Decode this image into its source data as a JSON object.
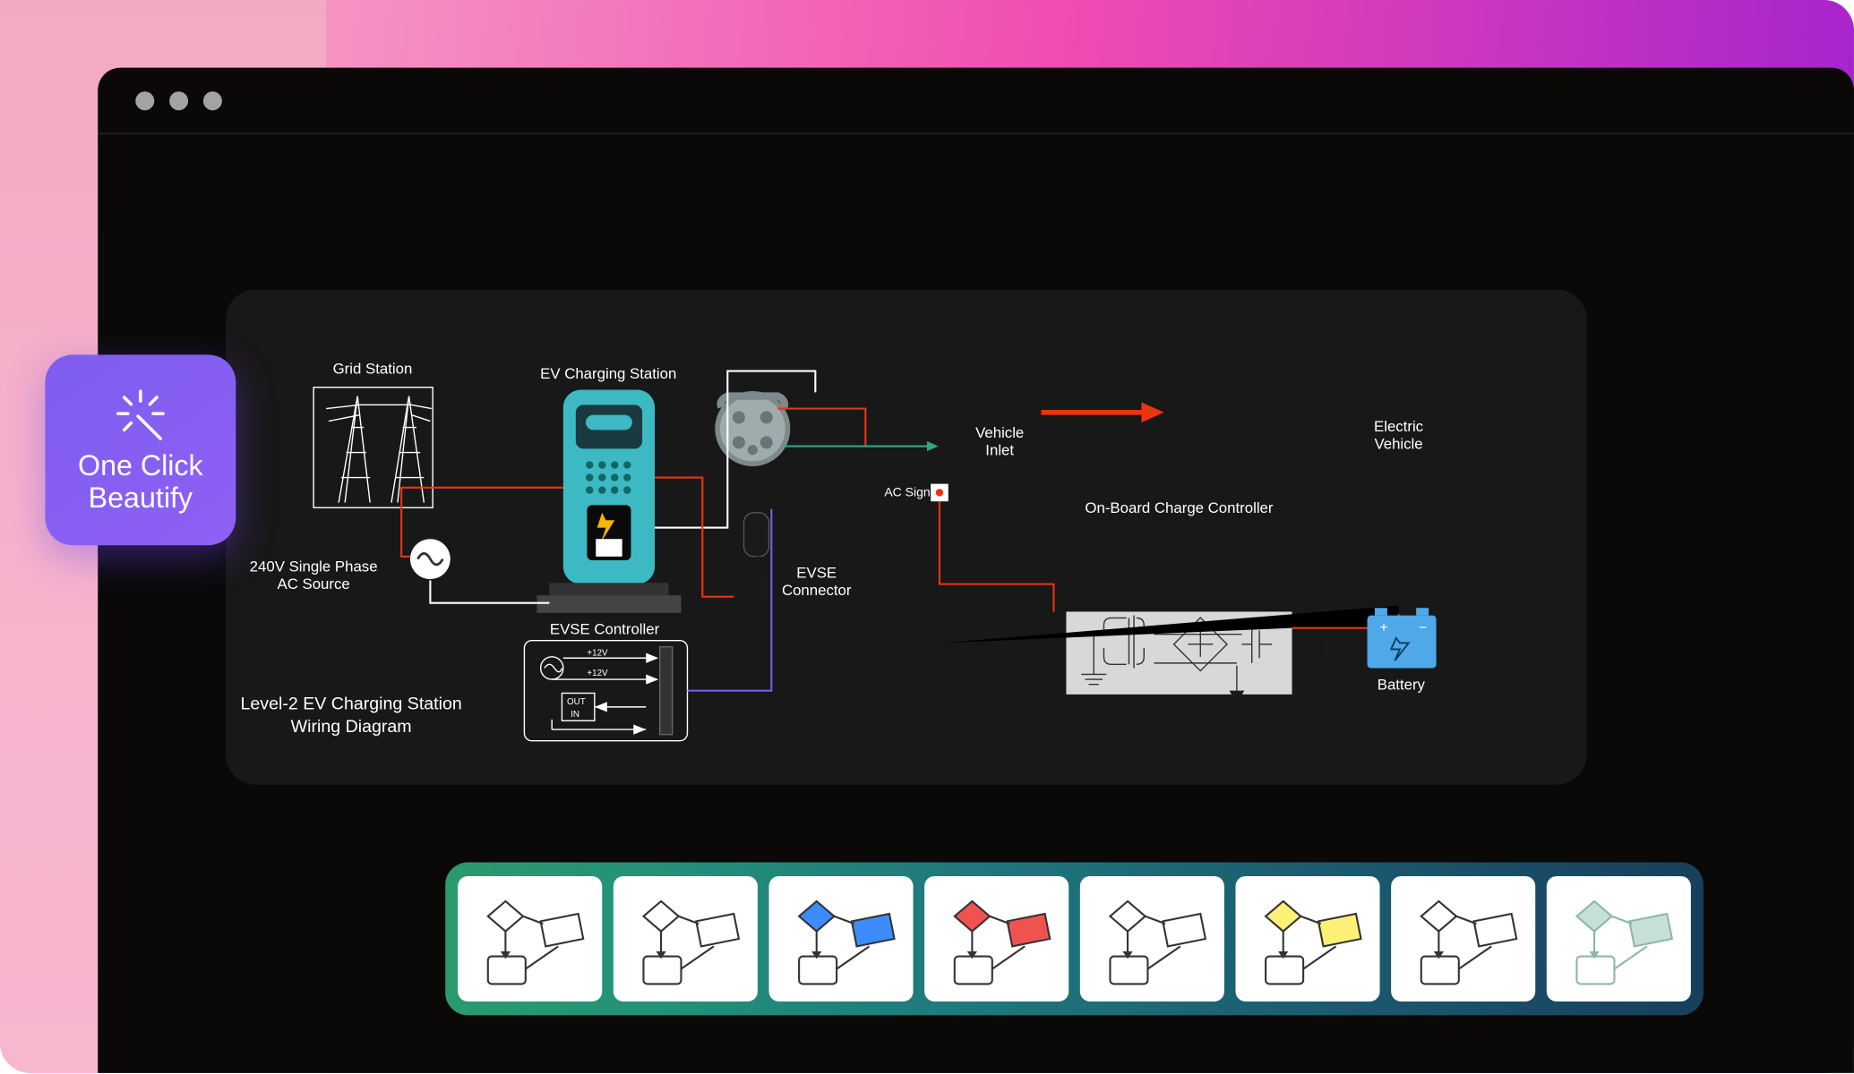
{
  "beautify": {
    "line1": "One Click",
    "line2": "Beautify"
  },
  "diagram": {
    "title_line1": "Level-2 EV Charging Station",
    "title_line2": "Wiring Diagram",
    "labels": {
      "grid_station": "Grid Station",
      "ev_charging_station": "EV Charging Station",
      "ac_source_l1": "240V Single Phase",
      "ac_source_l2": "AC Source",
      "evse_controller": "EVSE Controller",
      "evse_connector_l1": "EVSE",
      "evse_connector_l2": "Connector",
      "vehicle_inlet_l1": "Vehicle",
      "vehicle_inlet_l2": "Inlet",
      "ac_signal": "AC Signal",
      "onboard_charge_controller": "On-Board Charge Controller",
      "electric_vehicle_l1": "Electric",
      "electric_vehicle_l2": "Vehicle",
      "battery": "Battery",
      "plus12v": "+12V",
      "minus12v": "+12V",
      "out": "OUT",
      "in": "IN"
    }
  },
  "palette": {
    "themes": [
      {
        "name": "outline",
        "diamond": "none",
        "rect": "none",
        "stroke": "#333"
      },
      {
        "name": "outline-2",
        "diamond": "none",
        "rect": "none",
        "stroke": "#333"
      },
      {
        "name": "blue",
        "diamond": "#3d8bfd",
        "rect": "#3d8bfd",
        "stroke": "#333"
      },
      {
        "name": "red",
        "diamond": "#ef5350",
        "rect": "#ef5350",
        "stroke": "#333"
      },
      {
        "name": "outline-3",
        "diamond": "none",
        "rect": "none",
        "stroke": "#333"
      },
      {
        "name": "yellow",
        "diamond": "#fff176",
        "rect": "#fff176",
        "stroke": "#333"
      },
      {
        "name": "outline-4",
        "diamond": "none",
        "rect": "none",
        "stroke": "#333"
      },
      {
        "name": "pale-green",
        "diamond": "#c7e0d6",
        "rect": "#c7e0d6",
        "stroke": "#8db7a6"
      }
    ]
  }
}
